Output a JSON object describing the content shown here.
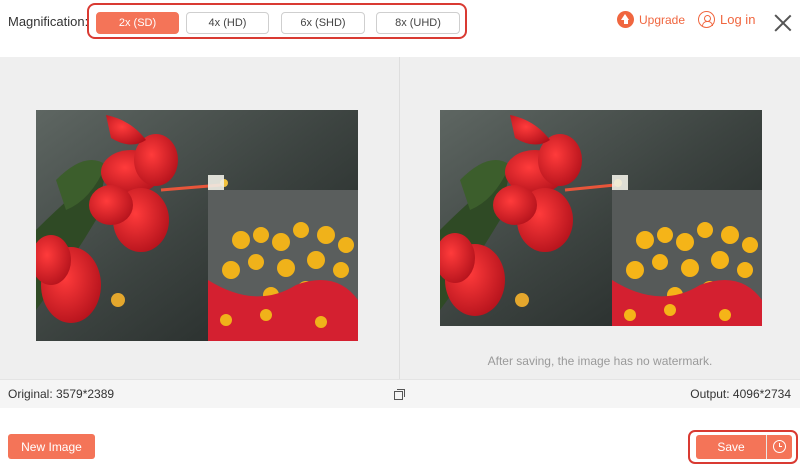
{
  "topbar": {
    "magnification_label": "Magnification:",
    "options": [
      "2x (SD)",
      "4x (HD)",
      "6x (SHD)",
      "8x (UHD)"
    ],
    "selected": "2x (SD)",
    "upgrade_label": "Upgrade",
    "login_label": "Log in"
  },
  "preview": {
    "watermark_note": "After saving, the image has no watermark."
  },
  "infobar": {
    "original": "Original: 3579*2389",
    "output": "Output: 4096*2734"
  },
  "actions": {
    "new_image_label": "New Image",
    "save_label": "Save"
  },
  "colors": {
    "accent": "#f47458",
    "highlight_border": "#d93a32",
    "link": "#f0663f"
  }
}
